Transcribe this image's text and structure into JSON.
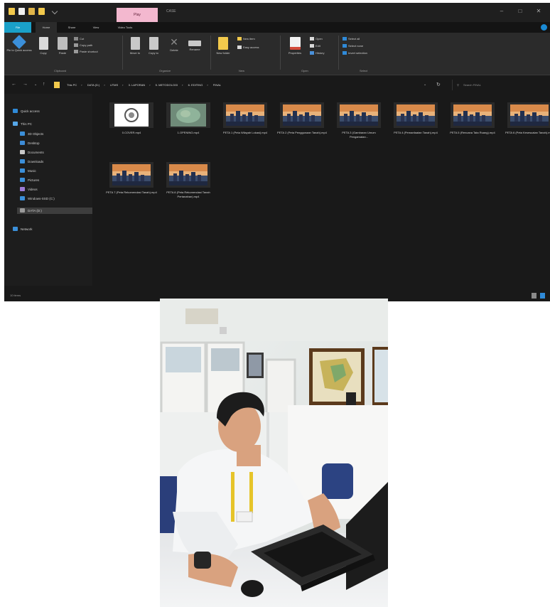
{
  "window": {
    "title": "CASE",
    "contextual_tab": "Play",
    "minimize": "–",
    "maximize": "□",
    "close": "✕"
  },
  "tabs": [
    "File",
    "Home",
    "Share",
    "View",
    "Video Tools"
  ],
  "ribbon": {
    "pin": "Pin to Quick access",
    "copy": "Copy",
    "paste": "Paste",
    "cut": "Cut",
    "copy_path": "Copy path",
    "paste_shortcut": "Paste shortcut",
    "move_to": "Move to",
    "copy_to": "Copy to",
    "delete": "Delete",
    "rename": "Rename",
    "new_folder": "New folder",
    "new_item": "New item",
    "easy_access": "Easy access",
    "properties": "Properties",
    "open": "Open",
    "edit": "Edit",
    "history": "History",
    "select_all": "Select all",
    "select_none": "Select none",
    "invert_selection": "Invert selection",
    "groups": [
      "Clipboard",
      "Organize",
      "New",
      "Open",
      "Select"
    ]
  },
  "address": {
    "segments": [
      "This PC",
      "DATA (D:)",
      "UTMS",
      "3. LAPORAN",
      "5. METODOLOGI",
      "6. EDITING",
      "FINAL"
    ],
    "search_placeholder": "Search FINAL"
  },
  "nav_pane": [
    {
      "label": "Quick access",
      "icon": "star-icon",
      "color": "#2f8ad8"
    },
    {
      "label": "This PC",
      "icon": "pc-icon",
      "color": "#56a7e8"
    },
    {
      "label": "3D Objects",
      "icon": "cube-icon",
      "color": "#3b8fd9"
    },
    {
      "label": "Desktop",
      "icon": "desktop-icon",
      "color": "#3d8bd6"
    },
    {
      "label": "Documents",
      "icon": "document-icon",
      "color": "#c9c9c9"
    },
    {
      "label": "Downloads",
      "icon": "download-icon",
      "color": "#3b8fd9"
    },
    {
      "label": "Music",
      "icon": "music-icon",
      "color": "#3b8fd9"
    },
    {
      "label": "Pictures",
      "icon": "picture-icon",
      "color": "#3b8fd9"
    },
    {
      "label": "Videos",
      "icon": "video-icon",
      "color": "#9b7bd4"
    },
    {
      "label": "Windows-SSD (C:)",
      "icon": "drive-icon",
      "color": "#3b8fd9"
    },
    {
      "label": "DATA (D:)",
      "icon": "drive-icon",
      "color": "#9a9a9a"
    },
    {
      "label": "Network",
      "icon": "network-icon",
      "color": "#3b8fd9"
    }
  ],
  "files": [
    {
      "name": "0.COVER.mp4",
      "thumb": "cover"
    },
    {
      "name": "1.OPENING.mp4",
      "thumb": "map"
    },
    {
      "name": "PETA 1 (Peta Wilayah Lokasi).mp4",
      "thumb": "city"
    },
    {
      "name": "PETA 2 (Peta Penggunaan Tanah).mp4",
      "thumb": "city"
    },
    {
      "name": "PETA 3 (Gambaran Umum Pengamatan...",
      "thumb": "city"
    },
    {
      "name": "PETA 4 (Pemanfaatan Tanah).mp4",
      "thumb": "city"
    },
    {
      "name": "PETA 5 (Rencana Tata Ruang).mp4",
      "thumb": "city"
    },
    {
      "name": "PETA 6 (Peta Kesesuaian Tanah).mp4",
      "thumb": "city"
    },
    {
      "name": "PETA 7 (Peta Rekomendasi Tanah).mp4",
      "thumb": "city"
    },
    {
      "name": "PETA 8 (Peta Rekomendasi Tanah Pertanahan).mp4",
      "thumb": "city"
    }
  ],
  "status": {
    "count": "10 items"
  },
  "colors": {
    "accent": "#1aa0c8",
    "contextual_tab": "#f3b8cf",
    "window_bg": "#191919"
  }
}
